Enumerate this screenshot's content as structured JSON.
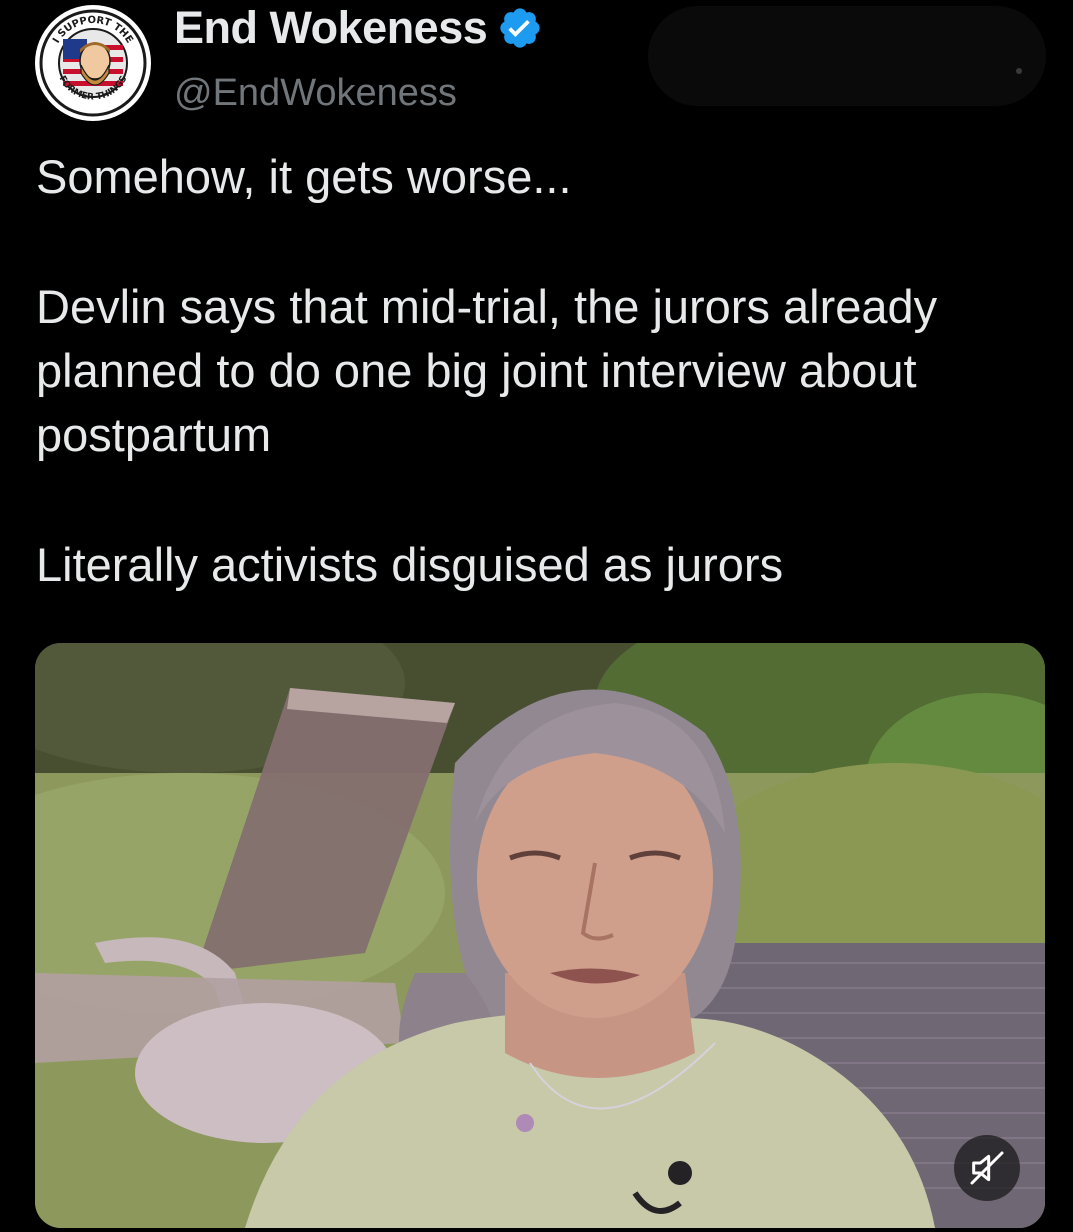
{
  "author": {
    "display_name": "End Wokeness",
    "handle": "@EndWokeness",
    "avatar_text_top": "I SUPPORT THE",
    "avatar_text_bottom": "FORMER THINGS",
    "verified": true,
    "verified_color": "#1d9bf0"
  },
  "tweet": {
    "paragraphs": [
      "Somehow, it gets worse...",
      "Devlin says that mid-trial, the jurors already planned to do one big joint interview about postpartum",
      "Literally activists disguised as jurors"
    ]
  },
  "media": {
    "type": "video",
    "mute_icon": "speaker-muted-icon"
  },
  "colors": {
    "background": "#000000",
    "text_primary": "#e7e9ea",
    "text_secondary": "#71767b",
    "accent": "#1d9bf0"
  }
}
